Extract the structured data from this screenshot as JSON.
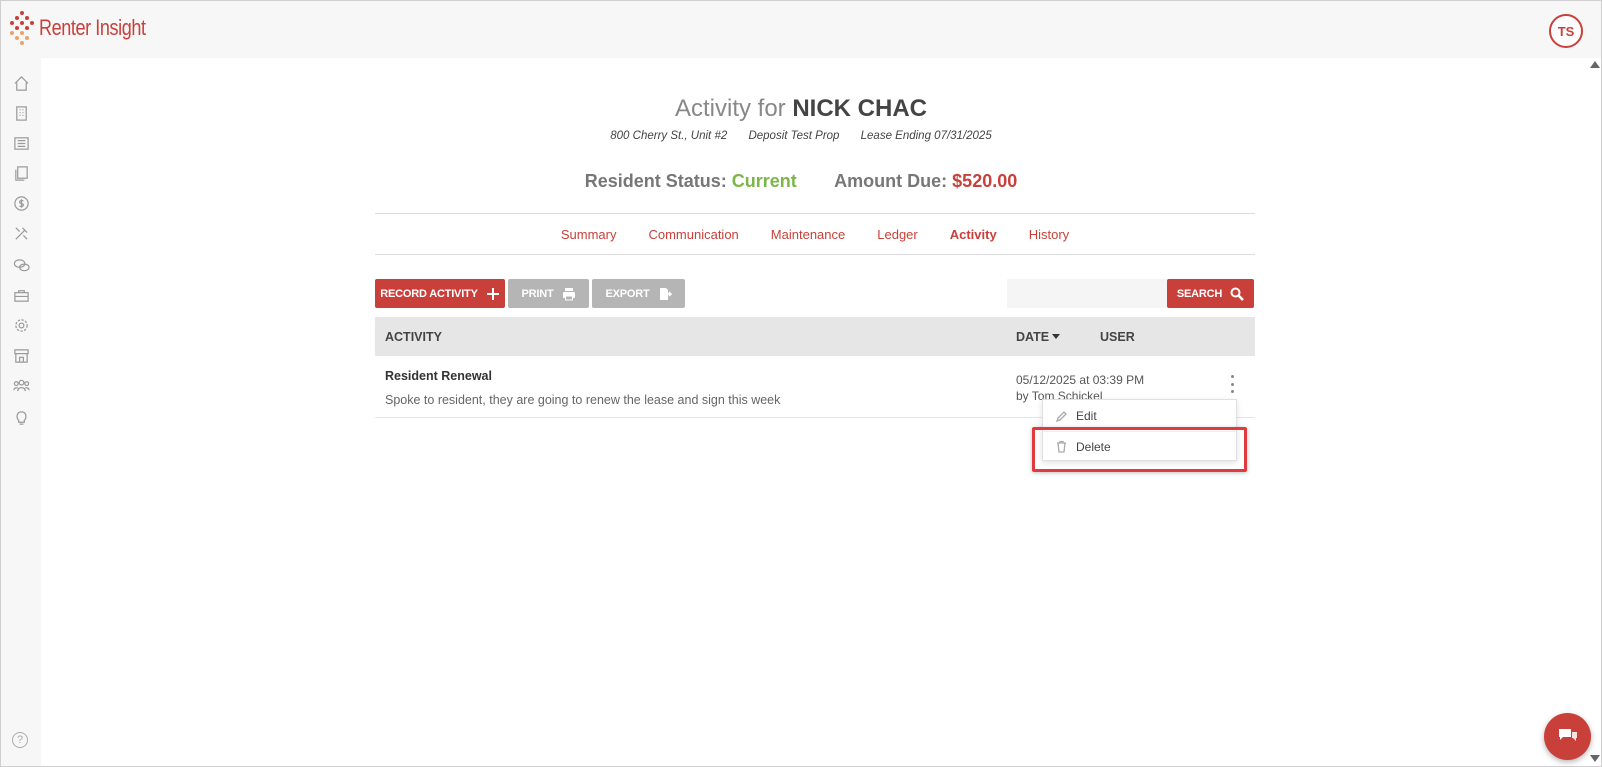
{
  "app": {
    "name": "Renter Insight",
    "user_initials": "TS"
  },
  "header": {
    "title_prefix": "Activity for",
    "resident_name": "NICK CHAC",
    "address": "800 Cherry St., Unit #2",
    "property": "Deposit Test Prop",
    "lease": "Lease Ending 07/31/2025",
    "status_label": "Resident Status:",
    "status_value": "Current",
    "amount_label": "Amount Due:",
    "amount_value": "$520.00"
  },
  "tabs": [
    {
      "label": "Summary"
    },
    {
      "label": "Communication"
    },
    {
      "label": "Maintenance"
    },
    {
      "label": "Ledger"
    },
    {
      "label": "Activity",
      "active": true
    },
    {
      "label": "History"
    }
  ],
  "toolbar": {
    "record_label": "RECORD ACTIVITY",
    "print_label": "PRINT",
    "export_label": "EXPORT",
    "search_label": "SEARCH",
    "search_placeholder": ""
  },
  "table": {
    "col_activity": "ACTIVITY",
    "col_date": "DATE",
    "col_user": "USER",
    "rows": [
      {
        "title": "Resident Renewal",
        "description": "Spoke to resident, they are going to renew the lease and sign this week",
        "date": "05/12/2025 at 03:39 PM",
        "user": "by Tom Schickel"
      }
    ]
  },
  "context_menu": {
    "edit_label": "Edit",
    "delete_label": "Delete"
  },
  "sidebar_icons": [
    "home-icon",
    "building-icon",
    "list-icon",
    "documents-icon",
    "dollar-icon",
    "tools-icon",
    "chat-bubbles-icon",
    "briefcase-icon",
    "gear-icon",
    "storefront-icon",
    "people-icon",
    "lightbulb-icon"
  ],
  "help_glyph": "?",
  "colors": {
    "brand": "#c9403a",
    "status_ok": "#7ab648",
    "highlight": "#e0393e"
  }
}
